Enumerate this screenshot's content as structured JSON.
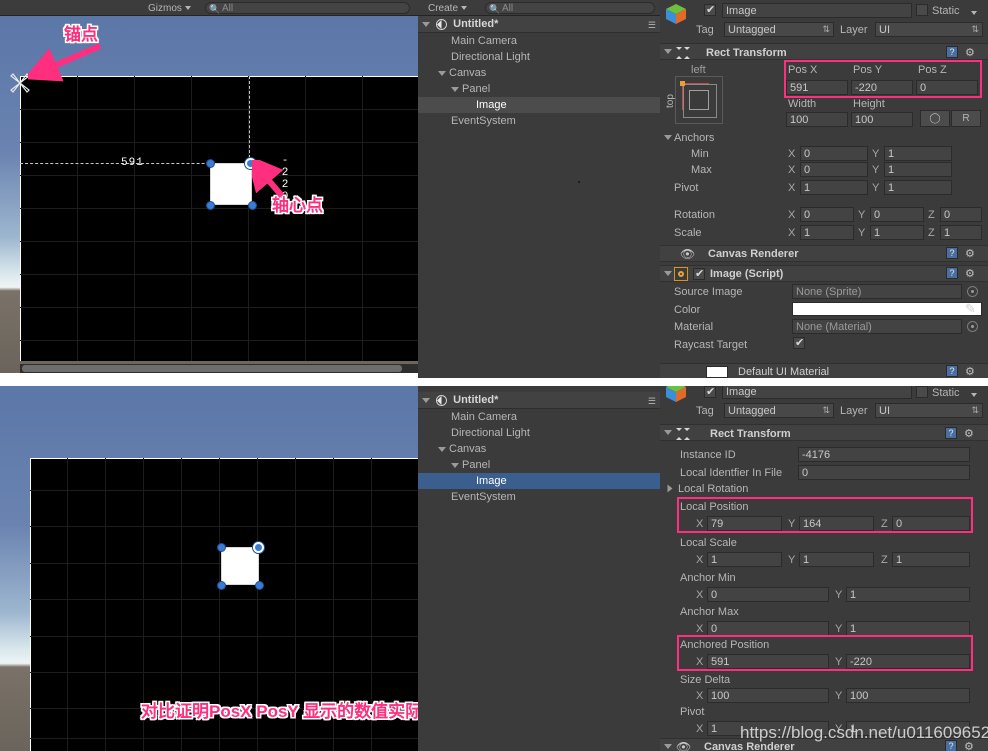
{
  "meta": {
    "app": "Unity Editor",
    "watermark": "https://blog.csdn.net/u011609652",
    "caption": "对比证明PosX PosY 显示的数值实际是anchoredPosition"
  },
  "toolbar_top": {
    "gizmos_label": "Gizmos",
    "scene_search_placeholder": "All",
    "create_label": "Create",
    "hierarchy_search_placeholder": "All",
    "search_icon": "search-icon"
  },
  "annotations": {
    "anchor_point": "锚点",
    "pivot_point": "轴心点"
  },
  "scene_top": {
    "measure_x": "591",
    "measure_y": "-220",
    "anchor_gizmo_icon": "anchor-gizmo-icon"
  },
  "hierarchy": {
    "scene_name": "Untitled*",
    "menu_icon": "hamburger-icon",
    "items": [
      {
        "label": "Main Camera",
        "depth": 1,
        "expandable": false,
        "selected": false
      },
      {
        "label": "Directional Light",
        "depth": 1,
        "expandable": false,
        "selected": false
      },
      {
        "label": "Canvas",
        "depth": 1,
        "expandable": true,
        "selected": false
      },
      {
        "label": "Panel",
        "depth": 2,
        "expandable": true,
        "selected": false
      },
      {
        "label": "Image",
        "depth": 3,
        "expandable": false,
        "selected": true
      },
      {
        "label": "EventSystem",
        "depth": 1,
        "expandable": false,
        "selected": false
      }
    ]
  },
  "inspector_top": {
    "gameobject_icon": "cube-icon",
    "active_checkbox": true,
    "name": "Image",
    "static_label": "Static",
    "static_checked": false,
    "tag_label": "Tag",
    "tag_value": "Untagged",
    "layer_label": "Layer",
    "layer_value": "UI",
    "rect_transform": {
      "title": "Rect Transform",
      "anchor_preset_h": "left",
      "anchor_preset_v": "top",
      "pos_x_label": "Pos X",
      "pos_x": "591",
      "pos_y_label": "Pos Y",
      "pos_y": "-220",
      "pos_z_label": "Pos Z",
      "pos_z": "0",
      "width_label": "Width",
      "width": "100",
      "height_label": "Height",
      "height": "100",
      "blueprint_btn": "blueprint-mode-icon",
      "raw_btn": "R",
      "anchors_label": "Anchors",
      "min_label": "Min",
      "min_x": "0",
      "min_y": "1",
      "max_label": "Max",
      "max_x": "0",
      "max_y": "1",
      "pivot_label": "Pivot",
      "pivot_x": "1",
      "pivot_y": "1",
      "rotation_label": "Rotation",
      "rot_x": "0",
      "rot_y": "0",
      "rot_z": "0",
      "scale_label": "Scale",
      "scale_x": "1",
      "scale_y": "1",
      "scale_z": "1"
    },
    "canvas_renderer": {
      "title": "Canvas Renderer",
      "icon": "eye-icon"
    },
    "image_script": {
      "title": "Image (Script)",
      "enabled": true,
      "source_image_label": "Source Image",
      "source_image_value": "None (Sprite)",
      "color_label": "Color",
      "color_value": "#FFFFFF",
      "material_label": "Material",
      "material_value": "None (Material)",
      "raycast_label": "Raycast Target",
      "raycast_checked": true
    },
    "default_material": {
      "title": "Default UI Material"
    }
  },
  "inspector_bottom": {
    "name": "Image",
    "static_label": "Static",
    "tag_label": "Tag",
    "tag_value": "Untagged",
    "layer_label": "Layer",
    "layer_value": "UI",
    "rect_transform": {
      "title": "Rect Transform",
      "instance_id_label": "Instance ID",
      "instance_id": "-4176",
      "local_identfier_label": "Local Identfier In File",
      "local_identfier": "0",
      "local_rotation_label": "Local Rotation",
      "local_position_label": "Local Position",
      "local_position": {
        "x": "79",
        "y": "164",
        "z": "0"
      },
      "local_scale_label": "Local Scale",
      "local_scale": {
        "x": "1",
        "y": "1",
        "z": "1"
      },
      "anchor_min_label": "Anchor Min",
      "anchor_min": {
        "x": "0",
        "y": "1"
      },
      "anchor_max_label": "Anchor Max",
      "anchor_max": {
        "x": "0",
        "y": "1"
      },
      "anchored_position_label": "Anchored Position",
      "anchored_position": {
        "x": "591",
        "y": "-220"
      },
      "size_delta_label": "Size Delta",
      "size_delta": {
        "x": "100",
        "y": "100"
      },
      "pivot_label": "Pivot",
      "pivot": {
        "x": "1",
        "y": "1"
      }
    },
    "canvas_renderer": {
      "title": "Canvas Renderer",
      "icon": "eye-icon"
    }
  },
  "colors": {
    "highlight": "#ff2e7e",
    "panel_bg": "#3b3b3b",
    "selection_blue": "#3a5f8f",
    "handle_blue": "#3a7bd5"
  }
}
